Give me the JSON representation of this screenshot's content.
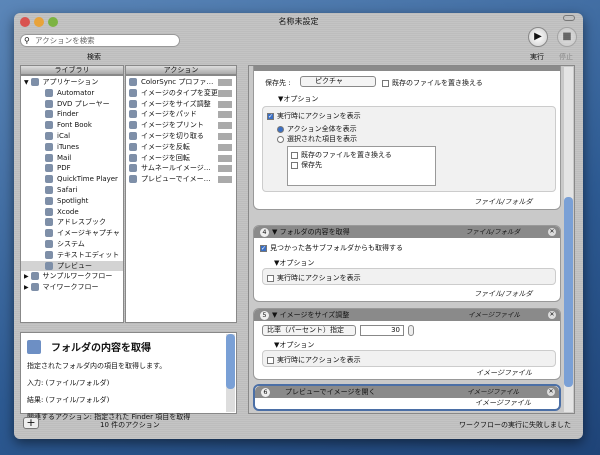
{
  "window": {
    "title": "名称未設定"
  },
  "toolbar": {
    "search_placeholder": "アクションを検索",
    "search_label": "検索",
    "run": "実行",
    "stop": "停止"
  },
  "library": {
    "header": "ライブラリ",
    "items": [
      {
        "label": "アプリケーション",
        "level": 0
      },
      {
        "label": "Automator",
        "level": 1
      },
      {
        "label": "DVD プレーヤー",
        "level": 1
      },
      {
        "label": "Finder",
        "level": 1
      },
      {
        "label": "Font Book",
        "level": 1
      },
      {
        "label": "iCal",
        "level": 1
      },
      {
        "label": "iTunes",
        "level": 1
      },
      {
        "label": "Mail",
        "level": 1
      },
      {
        "label": "PDF",
        "level": 1
      },
      {
        "label": "QuickTime Player",
        "level": 1
      },
      {
        "label": "Safari",
        "level": 1
      },
      {
        "label": "Spotlight",
        "level": 1
      },
      {
        "label": "Xcode",
        "level": 1
      },
      {
        "label": "アドレスブック",
        "level": 1
      },
      {
        "label": "イメージキャプチャ",
        "level": 1
      },
      {
        "label": "システム",
        "level": 1
      },
      {
        "label": "テキストエディット",
        "level": 1
      },
      {
        "label": "プレビュー",
        "level": 1,
        "selected": true
      },
      {
        "label": "サンプルワークフロー",
        "level": 0
      },
      {
        "label": "マイワークフロー",
        "level": 0
      }
    ]
  },
  "actions": {
    "header": "アクション",
    "items": [
      "ColorSync プロファ…",
      "イメージのタイプを変更",
      "イメージをサイズ調整",
      "イメージをパッド",
      "イメージをプリント",
      "イメージを切り取る",
      "イメージを反転",
      "イメージを回転",
      "サムネールイメージ…",
      "プレビューでイメー…"
    ]
  },
  "description": {
    "title": "フォルダの内容を取得",
    "text": "指定されたフォルダ内の項目を取得します。",
    "input": "入力: (ファイル/フォルダ)",
    "result": "結果: (ファイル/フォルダ)",
    "related": "関連するアクション: 指定された Finder 項目を取得"
  },
  "footer": {
    "count": "10 件のアクション",
    "status": "ワークフローの実行に失敗しました"
  },
  "workflow": {
    "a3": {
      "save_label": "保存先 :",
      "save_value": "ピクチャ",
      "replace": "既存のファイルを置き換える",
      "options": "▼オプション",
      "show": "実行時にアクションを表示",
      "show_all": "アクション全体を表示",
      "show_selected": "選択された項目を表示",
      "sub_items": [
        "既存のファイルを置き換える",
        "保存先"
      ],
      "output": "ファイル/フォルダ"
    },
    "a4": {
      "num": "4",
      "title": "▼ フォルダの内容を取得",
      "type": "ファイル/フォルダ",
      "sub": "見つかった各サブフォルダからも取得する",
      "options": "▼オプション",
      "show": "実行時にアクションを表示",
      "output": "ファイル/フォルダ"
    },
    "a5": {
      "num": "5",
      "title": "▼ イメージをサイズ調整",
      "type": "イメージファイル",
      "mode": "比率（パーセント）指定",
      "value": "30",
      "options": "▼オプション",
      "show": "実行時にアクションを表示",
      "output": "イメージファイル"
    },
    "a6": {
      "num": "6",
      "title": "プレビューでイメージを開く",
      "type": "イメージファイル",
      "output": "イメージファイル"
    }
  }
}
